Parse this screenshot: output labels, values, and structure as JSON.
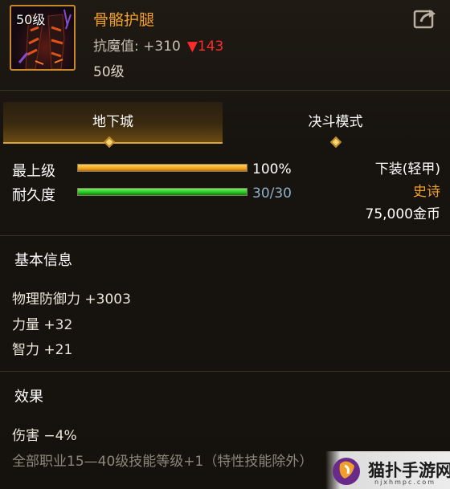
{
  "item": {
    "level_badge": "50级",
    "name": "骨骼护腿",
    "stat_label": "抗魔值: +310",
    "stat_down": "▼143",
    "level_text": "50级",
    "name_color": "#f0a02a"
  },
  "share_icon": "share-export-icon",
  "tabs": [
    {
      "label": "地下城",
      "active": true
    },
    {
      "label": "决斗模式",
      "active": false
    }
  ],
  "bars": {
    "grade": {
      "label": "最上级",
      "value_text": "100%",
      "fraction": 1.0,
      "color": "#f0a41e"
    },
    "durability": {
      "label": "耐久度",
      "value_text": "30/30",
      "fraction": 1.0,
      "color": "#22c21e"
    }
  },
  "right_info": {
    "slot": "下装(轻甲)",
    "rarity": "史诗",
    "rarity_color": "#f0a02a",
    "price": "75,000金币"
  },
  "basic_info": {
    "title": "基本信息",
    "lines": [
      "物理防御力 +3003",
      "力量 +32",
      "智力 +21"
    ]
  },
  "effects": {
    "title": "效果",
    "lines": [
      "伤害 −4%",
      "全部职业15—40级技能等级+1（特性技能除外）"
    ]
  },
  "watermark": {
    "text": "猫扑手游网",
    "url": "njxhmpc.com"
  }
}
